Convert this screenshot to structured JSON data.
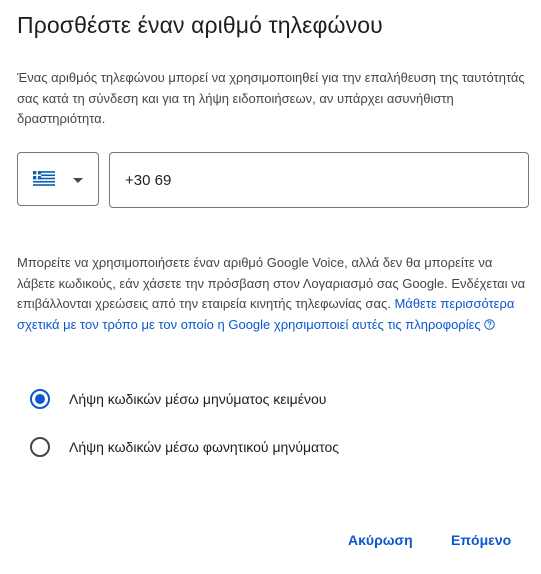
{
  "dialog": {
    "title": "Προσθέστε έναν αριθμό τηλεφώνου",
    "description": "Ένας αριθμός τηλεφώνου μπορεί να χρησιμοποιηθεί για την επαλήθευση της ταυτότητάς σας κατά τη σύνδεση και για τη λήψη ειδοποιήσεων, αν υπάρχει ασυνήθιστη δραστηριότητα."
  },
  "country_select": {
    "flag_icon": "greece-flag-icon",
    "dropdown_icon": "caret-down-icon"
  },
  "phone_input": {
    "value": "+30 69"
  },
  "notice": {
    "text": "Μπορείτε να χρησιμοποιήσετε έναν αριθμό Google Voice, αλλά δεν θα μπορείτε να λάβετε κωδικούς, εάν χάσετε την πρόσβαση στον Λογαριασμό σας Google. Ενδέχεται να επιβάλλονται χρεώσεις από την εταιρεία κινητής τηλεφωνίας σας. ",
    "link_text": "Μάθετε περισσότερα σχετικά με τον τρόπο με τον οποίο η Google χρησιμοποιεί αυτές τις πληροφορίες",
    "help_icon": "help-circle-icon"
  },
  "options": [
    {
      "label": "Λήψη κωδικών μέσω μηνύματος κειμένου",
      "selected": true
    },
    {
      "label": "Λήψη κωδικών μέσω φωνητικού μηνύματος",
      "selected": false
    }
  ],
  "actions": {
    "cancel": "Ακύρωση",
    "next": "Επόμενο"
  },
  "colors": {
    "accent": "#0b57d0",
    "text": "#1f1f1f",
    "secondary_text": "#444746",
    "border": "#747775"
  }
}
